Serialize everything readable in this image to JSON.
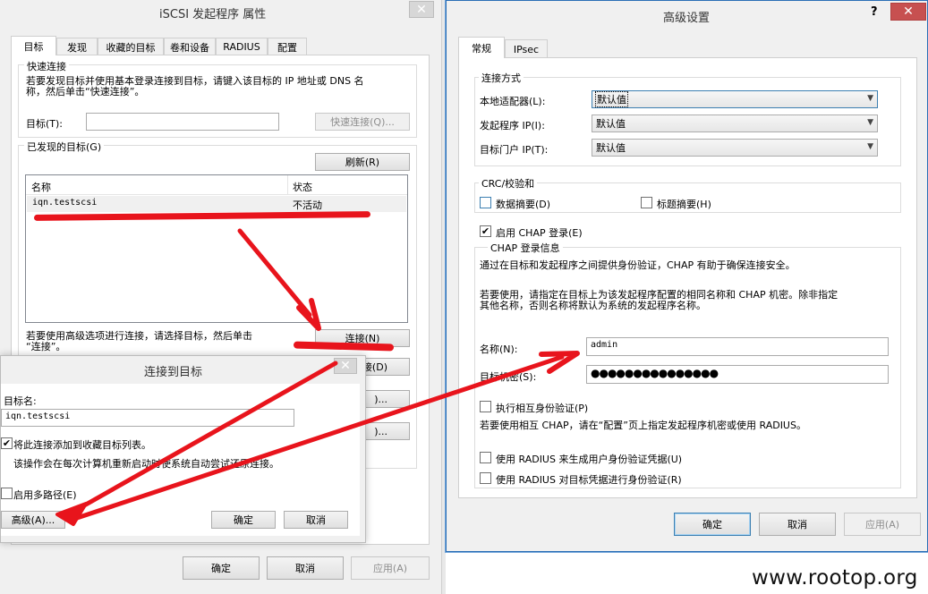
{
  "iscsi": {
    "title": "iSCSI 发起程序 属性",
    "tabs": [
      "目标",
      "发现",
      "收藏的目标",
      "卷和设备",
      "RADIUS",
      "配置"
    ],
    "quick": {
      "group": "快速连接",
      "desc1": "若要发现目标并使用基本登录连接到目标，请键入该目标的 IP 地址或 DNS 名",
      "desc2": "称，然后单击“快速连接”。",
      "target_label": "目标(T):",
      "target_value": "",
      "quick_button": "快速连接(Q)..."
    },
    "discovered": {
      "group": "已发现的目标(G)",
      "refresh": "刷新(R)",
      "col_name": "名称",
      "col_status": "状态",
      "rows": [
        {
          "name": "iqn.testscsi",
          "status": "不活动"
        }
      ],
      "adv_desc1": "若要使用高级选项进行连接，请选择目标，然后单击",
      "adv_desc2": "“连接”。",
      "connect": "连接(N)",
      "disconnect": "接(D)",
      "btn_a": ")...",
      "btn_b": ")..."
    },
    "ok": "确定",
    "cancel": "取消",
    "apply": "应用(A)"
  },
  "connect_dialog": {
    "title": "连接到目标",
    "target_name_label": "目标名:",
    "target_name_value": "iqn.testscsi",
    "add_favorite": "将此连接添加到收藏目标列表。",
    "add_favorite_checked": "✔",
    "favorite_desc": "该操作会在每次计算机重新启动时使系统自动尝试还原连接。",
    "multipath": "启用多路径(E)",
    "advanced": "高级(A)...",
    "ok": "确定",
    "cancel": "取消"
  },
  "advanced": {
    "title": "高级设置",
    "help": "?",
    "tabs": [
      "常规",
      "IPsec"
    ],
    "conn_group": "连接方式",
    "local_adapter_label": "本地适配器(L):",
    "local_adapter_value": "默认值",
    "initiator_ip_label": "发起程序 IP(I):",
    "initiator_ip_value": "默认值",
    "portal_ip_label": "目标门户 IP(T):",
    "portal_ip_value": "默认值",
    "crc_group": "CRC/校验和",
    "data_digest": "数据摘要(D)",
    "header_digest": "标题摘要(H)",
    "enable_chap": "启用 CHAP 登录(E)",
    "enable_chap_checked": "✔",
    "chap_group": "CHAP 登录信息",
    "chap_desc1": "通过在目标和发起程序之间提供身份验证，CHAP 有助于确保连接安全。",
    "chap_desc2": "若要使用，请指定在目标上为该发起程序配置的相同名称和 CHAP 机密。除非指定",
    "chap_desc3": "其他名称，否则名称将默认为系统的发起程序名称。",
    "name_label": "名称(N):",
    "name_value": "admin",
    "secret_label": "目标机密(S):",
    "secret_value": "●●●●●●●●●●●●●●●",
    "mutual": "执行相互身份验证(P)",
    "mutual_desc": "若要使用相互 CHAP，请在“配置”页上指定发起程序机密或使用 RADIUS。",
    "radius1": "使用 RADIUS 来生成用户身份验证凭据(U)",
    "radius2": "使用 RADIUS 对目标凭据进行身份验证(R)",
    "ok": "确定",
    "cancel": "取消",
    "apply": "应用(A)"
  },
  "watermark": "www.rootop.org",
  "accent_red": "#e8141c"
}
